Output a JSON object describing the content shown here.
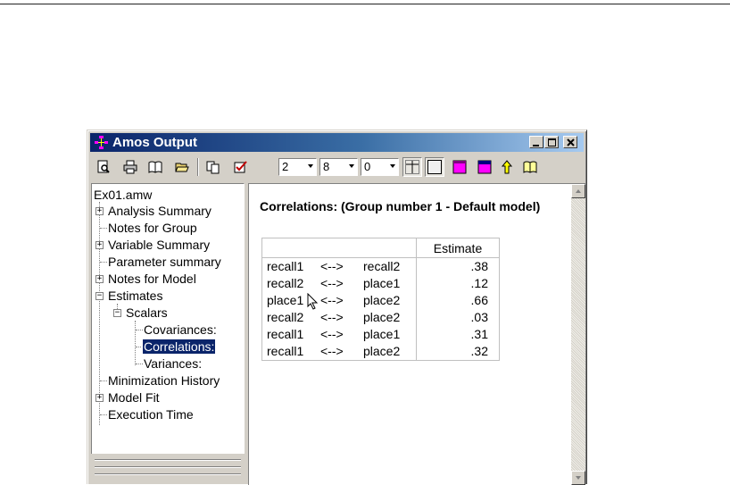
{
  "window": {
    "title": "Amos Output",
    "icon": "amos-path-diagram-icon"
  },
  "titlebar_buttons": [
    {
      "name": "minimize-button",
      "icon": "minimize-icon"
    },
    {
      "name": "maximize-button",
      "icon": "maximize-icon"
    },
    {
      "name": "close-button",
      "icon": "close-icon"
    }
  ],
  "toolbar": {
    "tools": [
      "print-preview-icon",
      "print-icon",
      "open-book-icon",
      "open-folder-icon",
      "copy-icon",
      "checkmark-options-icon"
    ],
    "combos": [
      {
        "name": "decimals-combo",
        "value": "2"
      },
      {
        "name": "column-width-combo",
        "value": "8"
      },
      {
        "name": "table-columns-combo",
        "value": "0"
      }
    ],
    "right_tools": [
      "table-grid-icon",
      "table-frame-icon",
      "table-color-magenta-icon",
      "table-color-purple-icon",
      "up-arrow-icon",
      "help-book-icon"
    ]
  },
  "tree": {
    "root": "Ex01.amw",
    "items": [
      {
        "label": "Analysis Summary",
        "expander": "+"
      },
      {
        "label": "Notes for Group",
        "expander": ""
      },
      {
        "label": "Variable Summary",
        "expander": "+"
      },
      {
        "label": "Parameter summary",
        "expander": ""
      },
      {
        "label": "Notes for Model",
        "expander": "+"
      },
      {
        "label": "Estimates",
        "expander": "-"
      },
      {
        "label": "Scalars",
        "expander": "-"
      },
      {
        "label": "Covariances:",
        "expander": ""
      },
      {
        "label": "Correlations:",
        "expander": "",
        "selected": true
      },
      {
        "label": "Variances:",
        "expander": ""
      },
      {
        "label": "Minimization History",
        "expander": ""
      },
      {
        "label": "Model Fit",
        "expander": "+"
      },
      {
        "label": "Execution Time",
        "expander": ""
      }
    ]
  },
  "content": {
    "heading": "Correlations: (Group number 1 - Default model)",
    "columns": [
      "",
      "Estimate"
    ],
    "rows": [
      {
        "var1": "recall1",
        "op": "<-->",
        "var2": "recall2",
        "estimate": ".38"
      },
      {
        "var1": "recall2",
        "op": "<-->",
        "var2": "place1",
        "estimate": ".12"
      },
      {
        "var1": "place1",
        "op": "<-->",
        "var2": "place2",
        "estimate": ".66"
      },
      {
        "var1": "recall2",
        "op": "<-->",
        "var2": "place2",
        "estimate": ".03"
      },
      {
        "var1": "recall1",
        "op": "<-->",
        "var2": "place1",
        "estimate": ".31"
      },
      {
        "var1": "recall1",
        "op": "<-->",
        "var2": "place2",
        "estimate": ".32"
      }
    ]
  },
  "colors": {
    "title_gradient_start": "#0a246a",
    "title_gradient_end": "#a6caf0",
    "selection": "#0a246a",
    "chrome": "#d4d0c8"
  }
}
